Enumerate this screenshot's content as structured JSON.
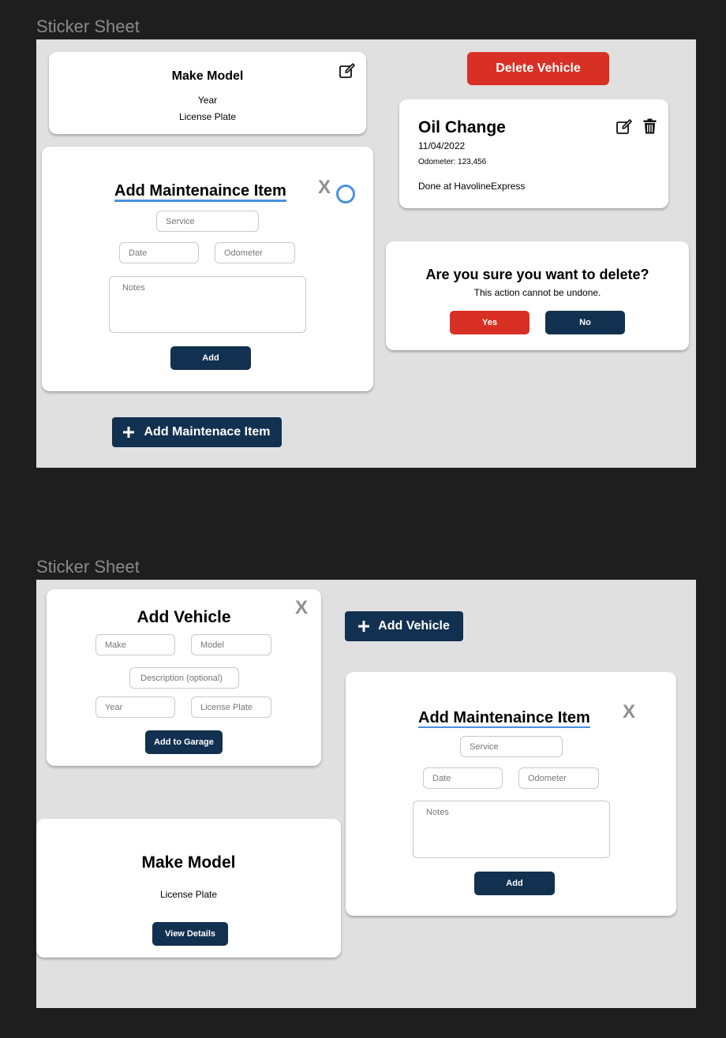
{
  "sheet1": {
    "label": "Sticker Sheet",
    "vehicle_card": {
      "title": "Make Model",
      "year": "Year",
      "plate": "License Plate",
      "edit_icon": "edit-icon"
    },
    "delete_vehicle_label": "Delete Vehicle",
    "maint_form": {
      "title": "Add Maintenaince Item",
      "close": "X",
      "service_placeholder": "Service",
      "date_placeholder": "Date",
      "odometer_placeholder": "Odometer",
      "notes_placeholder": "Notes",
      "add_label": "Add"
    },
    "entry": {
      "title": "Oil Change",
      "date": "11/04/2022",
      "odometer": "Odometer: 123,456",
      "done_at": "Done at HavolineExpress",
      "edit_icon": "edit-icon",
      "delete_icon": "trash-icon"
    },
    "confirm": {
      "title": "Are you sure you want to delete?",
      "subtitle": "This action cannot be undone.",
      "yes": "Yes",
      "no": "No"
    },
    "add_item_button": {
      "icon": "plus-icon",
      "label": "Add Maintenace Item"
    }
  },
  "sheet2": {
    "label": "Sticker Sheet",
    "vehicle_form": {
      "title": "Add Vehicle",
      "close": "X",
      "make_placeholder": "Make",
      "model_placeholder": "Model",
      "description_placeholder": "Description (optional)",
      "year_placeholder": "Year",
      "plate_placeholder": "License Plate",
      "submit": "Add to Garage"
    },
    "add_vehicle_button": {
      "icon": "plus-icon",
      "label": "Add Vehicle"
    },
    "maint_form": {
      "title": "Add Maintenaince Item",
      "close": "X",
      "service_placeholder": "Service",
      "date_placeholder": "Date",
      "odometer_placeholder": "Odometer",
      "notes_placeholder": "Notes",
      "add_label": "Add"
    },
    "vehicle_summary": {
      "title": "Make Model",
      "plate": "License Plate",
      "details": "View Details"
    }
  },
  "colors": {
    "navy": "#12304f",
    "red": "#d93025",
    "focus_blue": "#4a90e2",
    "canvas": "#1e1e1e",
    "sheet": "#e0e0e0"
  }
}
